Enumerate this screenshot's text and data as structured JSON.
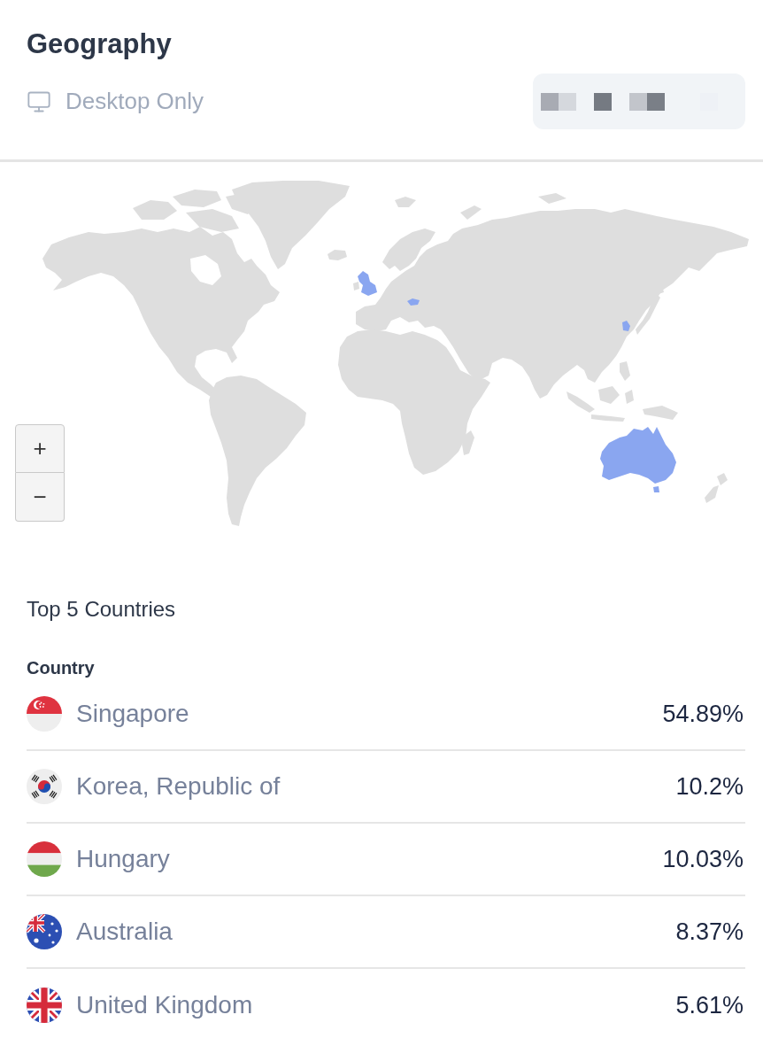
{
  "header": {
    "title": "Geography",
    "subtitle": "Desktop Only"
  },
  "map": {
    "zoom_buttons": [
      "+",
      "−"
    ]
  },
  "top_countries": {
    "title": "Top 5 Countries",
    "column": "Country",
    "rows": [
      {
        "country": "Singapore",
        "share": "54.89%"
      },
      {
        "country": "Korea, Republic of",
        "share": "10.2%"
      },
      {
        "country": "Hungary",
        "share": "10.03%"
      },
      {
        "country": "Australia",
        "share": "8.37%"
      },
      {
        "country": "United Kingdom",
        "share": "5.61%"
      }
    ]
  }
}
